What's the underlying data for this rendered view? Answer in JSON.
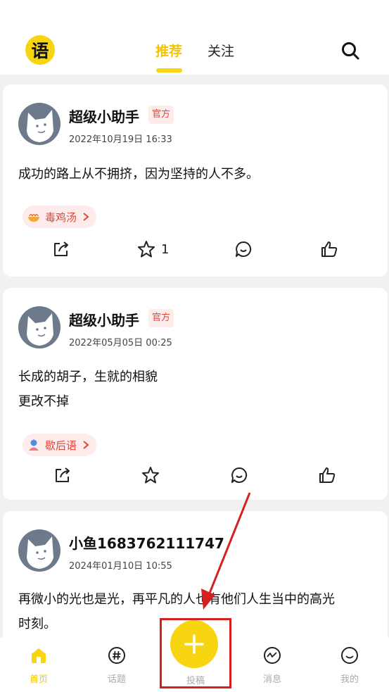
{
  "header": {
    "logo_char": "语",
    "tabs": [
      {
        "label": "推荐",
        "active": true
      },
      {
        "label": "关注",
        "active": false
      }
    ],
    "search_icon": "search-icon"
  },
  "posts": [
    {
      "author": "超级小助手",
      "badge": "官方",
      "timestamp": "2022年10月19日 16:33",
      "content_lines": [
        "成功的路上从不拥挤，因为坚持的人不多。"
      ],
      "tag": {
        "label": "毒鸡汤",
        "icon": "noodle-bowl-icon"
      },
      "actions": {
        "share": "share-icon",
        "favorite_count": "1",
        "comment": "comment-icon",
        "like": "thumbs-up-icon"
      }
    },
    {
      "author": "超级小助手",
      "badge": "官方",
      "timestamp": "2022年05月05日 00:25",
      "content_lines": [
        "长成的胡子，生就的相貌",
        "更改不掉"
      ],
      "tag": {
        "label": "歇后语",
        "icon": "person-icon"
      },
      "actions": {
        "share": "share-icon",
        "favorite_count": "",
        "comment": "comment-icon",
        "like": "thumbs-up-icon"
      }
    },
    {
      "author": "小鱼1683762111747",
      "badge": "",
      "timestamp": "2024年01月10日 10:55",
      "content_lines": [
        "再微小的光也是光，再平凡的人也有他们人生当中的高光",
        "时刻。"
      ]
    }
  ],
  "bottom_nav": [
    {
      "label": "首页",
      "icon": "home-icon",
      "active": true
    },
    {
      "label": "话题",
      "icon": "hashtag-icon",
      "active": false
    },
    {
      "label": "投稿",
      "icon": "plus-icon",
      "active": false
    },
    {
      "label": "消息",
      "icon": "activity-icon",
      "active": false
    },
    {
      "label": "我的",
      "icon": "smile-icon",
      "active": false
    }
  ],
  "colors": {
    "accent": "#f8d511",
    "accent_text": "#f4c500",
    "tag_bg": "#fdeceb",
    "tag_text": "#e0463d",
    "annotation": "#d32020"
  }
}
